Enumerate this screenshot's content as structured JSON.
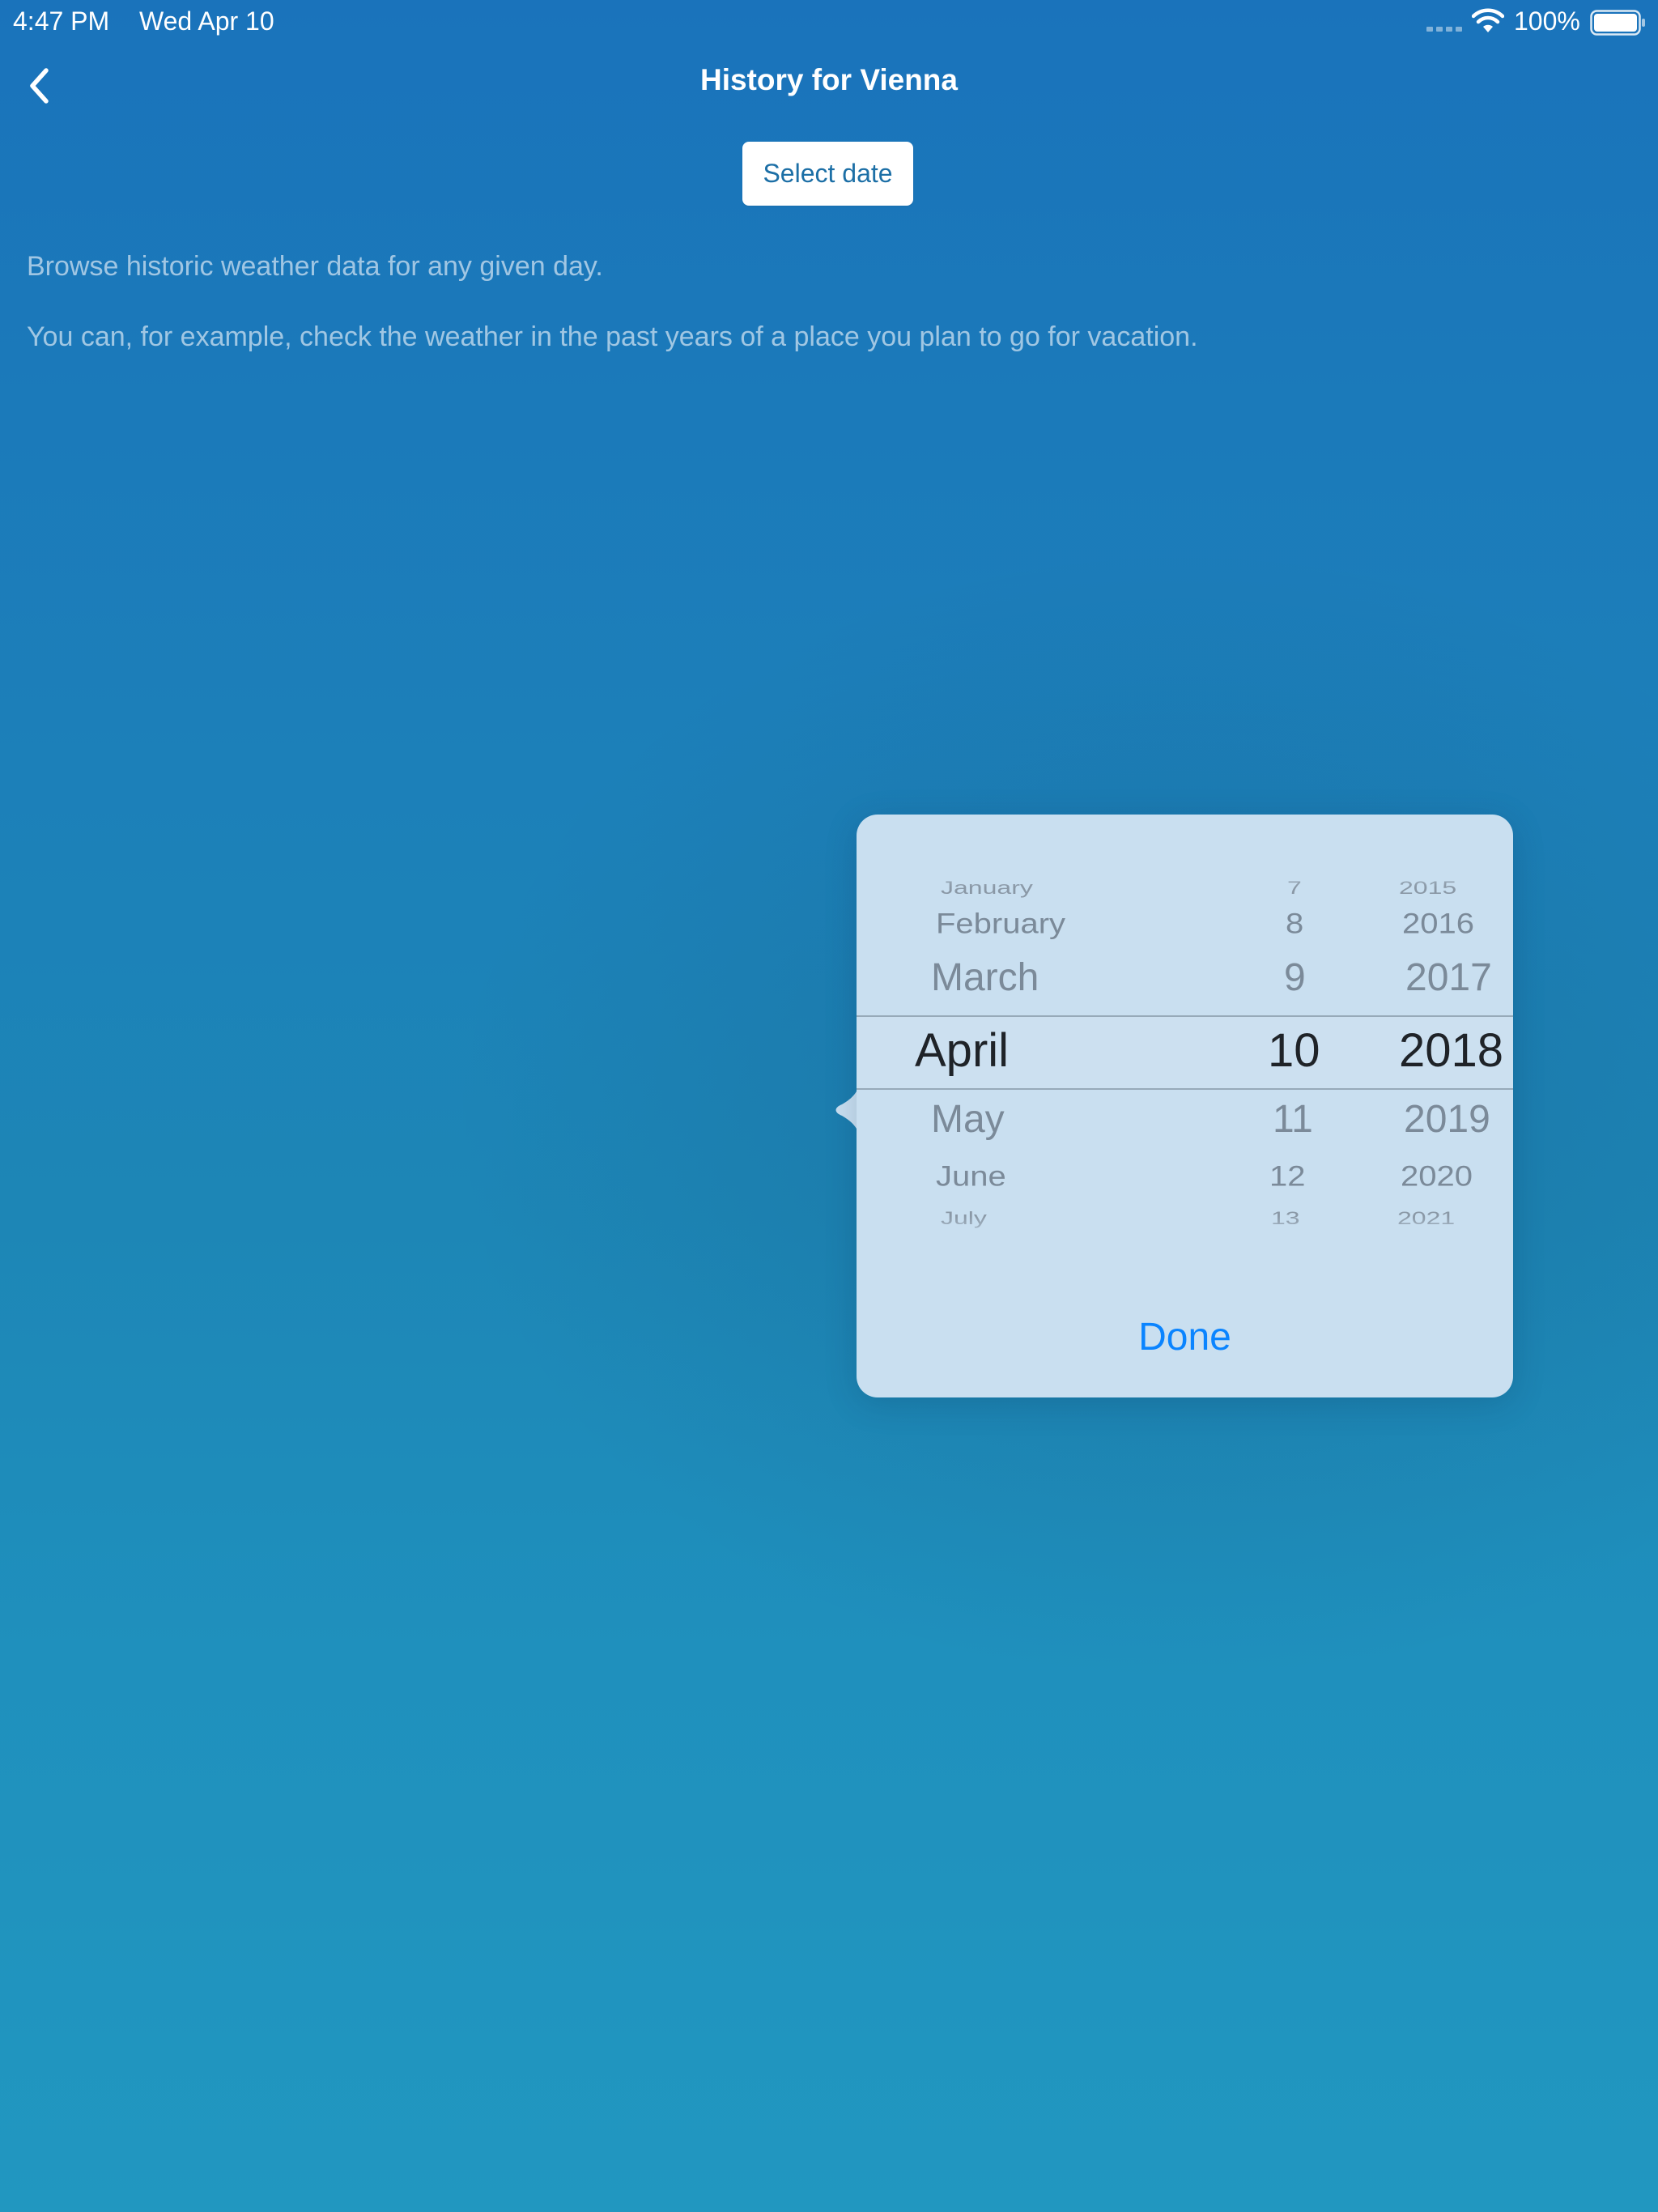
{
  "status_bar": {
    "time": "4:47 PM",
    "date": "Wed Apr 10",
    "battery_percent": "100%",
    "signal_icon": "cellular-signal-icon",
    "wifi_icon": "wifi-icon",
    "battery_icon": "battery-icon"
  },
  "nav": {
    "title": "History for Vienna",
    "back_icon": "chevron-left-icon"
  },
  "select_date_button": "Select date",
  "intro": {
    "line1": "Browse historic weather data for any given day.",
    "line2": "You can, for example, check the weather in the past years of a place you plan to go for vacation."
  },
  "date_picker": {
    "months": {
      "above": [
        "January",
        "February",
        "March"
      ],
      "selected": "April",
      "below": [
        "May",
        "June",
        "July"
      ]
    },
    "days": {
      "above": [
        "7",
        "8",
        "9"
      ],
      "selected": "10",
      "below": [
        "11",
        "12",
        "13"
      ]
    },
    "years": {
      "above": [
        "2015",
        "2016",
        "2017"
      ],
      "selected": "2018",
      "below": [
        "2019",
        "2020",
        "2021"
      ]
    },
    "done_label": "Done"
  },
  "colors": {
    "background_top": "#1a73bb",
    "background_bottom": "#2197c0",
    "popover": "#c9dff0",
    "done_blue": "#0a84ff",
    "button_text": "#1c6fa6"
  }
}
